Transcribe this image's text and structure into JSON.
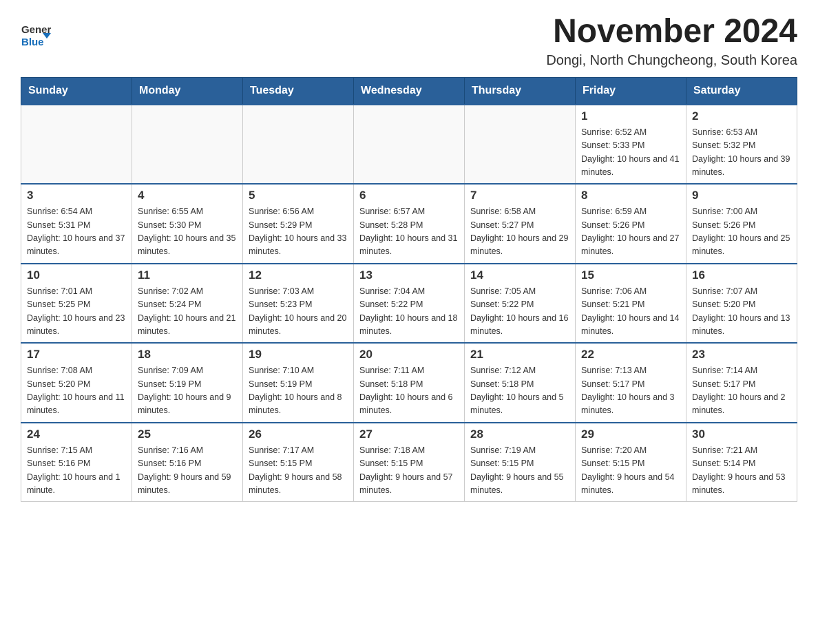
{
  "header": {
    "logo_text_general": "General",
    "logo_text_blue": "Blue",
    "month_title": "November 2024",
    "location": "Dongi, North Chungcheong, South Korea"
  },
  "days_of_week": [
    "Sunday",
    "Monday",
    "Tuesday",
    "Wednesday",
    "Thursday",
    "Friday",
    "Saturday"
  ],
  "weeks": [
    [
      {
        "day": "",
        "empty": true
      },
      {
        "day": "",
        "empty": true
      },
      {
        "day": "",
        "empty": true
      },
      {
        "day": "",
        "empty": true
      },
      {
        "day": "",
        "empty": true
      },
      {
        "day": "1",
        "sunrise": "Sunrise: 6:52 AM",
        "sunset": "Sunset: 5:33 PM",
        "daylight": "Daylight: 10 hours and 41 minutes."
      },
      {
        "day": "2",
        "sunrise": "Sunrise: 6:53 AM",
        "sunset": "Sunset: 5:32 PM",
        "daylight": "Daylight: 10 hours and 39 minutes."
      }
    ],
    [
      {
        "day": "3",
        "sunrise": "Sunrise: 6:54 AM",
        "sunset": "Sunset: 5:31 PM",
        "daylight": "Daylight: 10 hours and 37 minutes."
      },
      {
        "day": "4",
        "sunrise": "Sunrise: 6:55 AM",
        "sunset": "Sunset: 5:30 PM",
        "daylight": "Daylight: 10 hours and 35 minutes."
      },
      {
        "day": "5",
        "sunrise": "Sunrise: 6:56 AM",
        "sunset": "Sunset: 5:29 PM",
        "daylight": "Daylight: 10 hours and 33 minutes."
      },
      {
        "day": "6",
        "sunrise": "Sunrise: 6:57 AM",
        "sunset": "Sunset: 5:28 PM",
        "daylight": "Daylight: 10 hours and 31 minutes."
      },
      {
        "day": "7",
        "sunrise": "Sunrise: 6:58 AM",
        "sunset": "Sunset: 5:27 PM",
        "daylight": "Daylight: 10 hours and 29 minutes."
      },
      {
        "day": "8",
        "sunrise": "Sunrise: 6:59 AM",
        "sunset": "Sunset: 5:26 PM",
        "daylight": "Daylight: 10 hours and 27 minutes."
      },
      {
        "day": "9",
        "sunrise": "Sunrise: 7:00 AM",
        "sunset": "Sunset: 5:26 PM",
        "daylight": "Daylight: 10 hours and 25 minutes."
      }
    ],
    [
      {
        "day": "10",
        "sunrise": "Sunrise: 7:01 AM",
        "sunset": "Sunset: 5:25 PM",
        "daylight": "Daylight: 10 hours and 23 minutes."
      },
      {
        "day": "11",
        "sunrise": "Sunrise: 7:02 AM",
        "sunset": "Sunset: 5:24 PM",
        "daylight": "Daylight: 10 hours and 21 minutes."
      },
      {
        "day": "12",
        "sunrise": "Sunrise: 7:03 AM",
        "sunset": "Sunset: 5:23 PM",
        "daylight": "Daylight: 10 hours and 20 minutes."
      },
      {
        "day": "13",
        "sunrise": "Sunrise: 7:04 AM",
        "sunset": "Sunset: 5:22 PM",
        "daylight": "Daylight: 10 hours and 18 minutes."
      },
      {
        "day": "14",
        "sunrise": "Sunrise: 7:05 AM",
        "sunset": "Sunset: 5:22 PM",
        "daylight": "Daylight: 10 hours and 16 minutes."
      },
      {
        "day": "15",
        "sunrise": "Sunrise: 7:06 AM",
        "sunset": "Sunset: 5:21 PM",
        "daylight": "Daylight: 10 hours and 14 minutes."
      },
      {
        "day": "16",
        "sunrise": "Sunrise: 7:07 AM",
        "sunset": "Sunset: 5:20 PM",
        "daylight": "Daylight: 10 hours and 13 minutes."
      }
    ],
    [
      {
        "day": "17",
        "sunrise": "Sunrise: 7:08 AM",
        "sunset": "Sunset: 5:20 PM",
        "daylight": "Daylight: 10 hours and 11 minutes."
      },
      {
        "day": "18",
        "sunrise": "Sunrise: 7:09 AM",
        "sunset": "Sunset: 5:19 PM",
        "daylight": "Daylight: 10 hours and 9 minutes."
      },
      {
        "day": "19",
        "sunrise": "Sunrise: 7:10 AM",
        "sunset": "Sunset: 5:19 PM",
        "daylight": "Daylight: 10 hours and 8 minutes."
      },
      {
        "day": "20",
        "sunrise": "Sunrise: 7:11 AM",
        "sunset": "Sunset: 5:18 PM",
        "daylight": "Daylight: 10 hours and 6 minutes."
      },
      {
        "day": "21",
        "sunrise": "Sunrise: 7:12 AM",
        "sunset": "Sunset: 5:18 PM",
        "daylight": "Daylight: 10 hours and 5 minutes."
      },
      {
        "day": "22",
        "sunrise": "Sunrise: 7:13 AM",
        "sunset": "Sunset: 5:17 PM",
        "daylight": "Daylight: 10 hours and 3 minutes."
      },
      {
        "day": "23",
        "sunrise": "Sunrise: 7:14 AM",
        "sunset": "Sunset: 5:17 PM",
        "daylight": "Daylight: 10 hours and 2 minutes."
      }
    ],
    [
      {
        "day": "24",
        "sunrise": "Sunrise: 7:15 AM",
        "sunset": "Sunset: 5:16 PM",
        "daylight": "Daylight: 10 hours and 1 minute."
      },
      {
        "day": "25",
        "sunrise": "Sunrise: 7:16 AM",
        "sunset": "Sunset: 5:16 PM",
        "daylight": "Daylight: 9 hours and 59 minutes."
      },
      {
        "day": "26",
        "sunrise": "Sunrise: 7:17 AM",
        "sunset": "Sunset: 5:15 PM",
        "daylight": "Daylight: 9 hours and 58 minutes."
      },
      {
        "day": "27",
        "sunrise": "Sunrise: 7:18 AM",
        "sunset": "Sunset: 5:15 PM",
        "daylight": "Daylight: 9 hours and 57 minutes."
      },
      {
        "day": "28",
        "sunrise": "Sunrise: 7:19 AM",
        "sunset": "Sunset: 5:15 PM",
        "daylight": "Daylight: 9 hours and 55 minutes."
      },
      {
        "day": "29",
        "sunrise": "Sunrise: 7:20 AM",
        "sunset": "Sunset: 5:15 PM",
        "daylight": "Daylight: 9 hours and 54 minutes."
      },
      {
        "day": "30",
        "sunrise": "Sunrise: 7:21 AM",
        "sunset": "Sunset: 5:14 PM",
        "daylight": "Daylight: 9 hours and 53 minutes."
      }
    ]
  ]
}
